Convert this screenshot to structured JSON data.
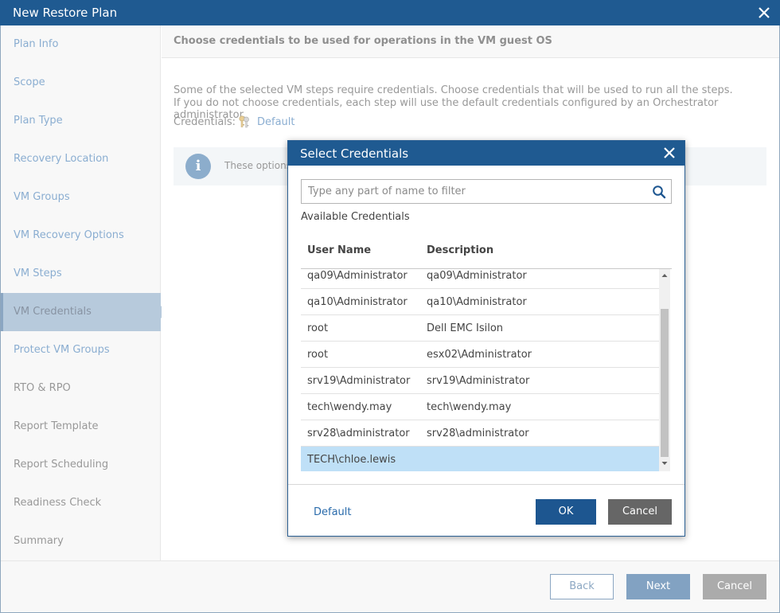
{
  "window": {
    "title": "New Restore Plan"
  },
  "sidebar": {
    "items": [
      {
        "label": "Plan Info",
        "state": "link"
      },
      {
        "label": "Scope",
        "state": "link"
      },
      {
        "label": "Plan Type",
        "state": "link"
      },
      {
        "label": "Recovery Location",
        "state": "link"
      },
      {
        "label": "VM Groups",
        "state": "link"
      },
      {
        "label": "VM Recovery Options",
        "state": "link"
      },
      {
        "label": "VM Steps",
        "state": "link"
      },
      {
        "label": "VM Credentials",
        "state": "active"
      },
      {
        "label": "Protect VM Groups",
        "state": "link"
      },
      {
        "label": "RTO & RPO",
        "state": "plain"
      },
      {
        "label": "Report Template",
        "state": "plain"
      },
      {
        "label": "Report Scheduling",
        "state": "plain"
      },
      {
        "label": "Readiness Check",
        "state": "plain"
      },
      {
        "label": "Summary",
        "state": "plain"
      }
    ]
  },
  "main": {
    "heading": "Choose credentials to be used for operations in the VM guest OS",
    "description_line1": "Some of the selected VM steps require credentials. Choose credentials that will be used to run all the steps.",
    "description_line2": "If you do not choose credentials, each step will use the default credentials configured by an Orchestrator administrator.",
    "credentials_label": "Credentials:",
    "credentials_value": "Default",
    "info_text": "These options"
  },
  "footer": {
    "back": "Back",
    "next": "Next",
    "cancel": "Cancel"
  },
  "dialog": {
    "title": "Select Credentials",
    "search_placeholder": "Type any part of name to filter",
    "available_label": "Available Credentials",
    "columns": {
      "user_name": "User Name",
      "description": "Description"
    },
    "rows": [
      {
        "user": "qa09\\Administrator",
        "desc": "qa09\\Administrator"
      },
      {
        "user": "qa10\\Administrator",
        "desc": "qa10\\Administrator"
      },
      {
        "user": "root",
        "desc": "Dell EMC Isilon"
      },
      {
        "user": "root",
        "desc": "esx02\\Administrator"
      },
      {
        "user": "srv19\\Administrator",
        "desc": "srv19\\Administrator"
      },
      {
        "user": "tech\\wendy.may",
        "desc": "tech\\wendy.may"
      },
      {
        "user": "srv28\\administrator",
        "desc": "srv28\\administrator"
      },
      {
        "user": "TECH\\chloe.lewis",
        "desc": ""
      }
    ],
    "selected_row": 7,
    "default_link": "Default",
    "ok": "OK",
    "cancel": "Cancel"
  },
  "colors": {
    "title_bar": "#1f5a91",
    "primary_button": "#1d5690",
    "link": "#2a6bab",
    "selected_row": "#bfe0f7",
    "active_nav": "#7d9fc0"
  }
}
